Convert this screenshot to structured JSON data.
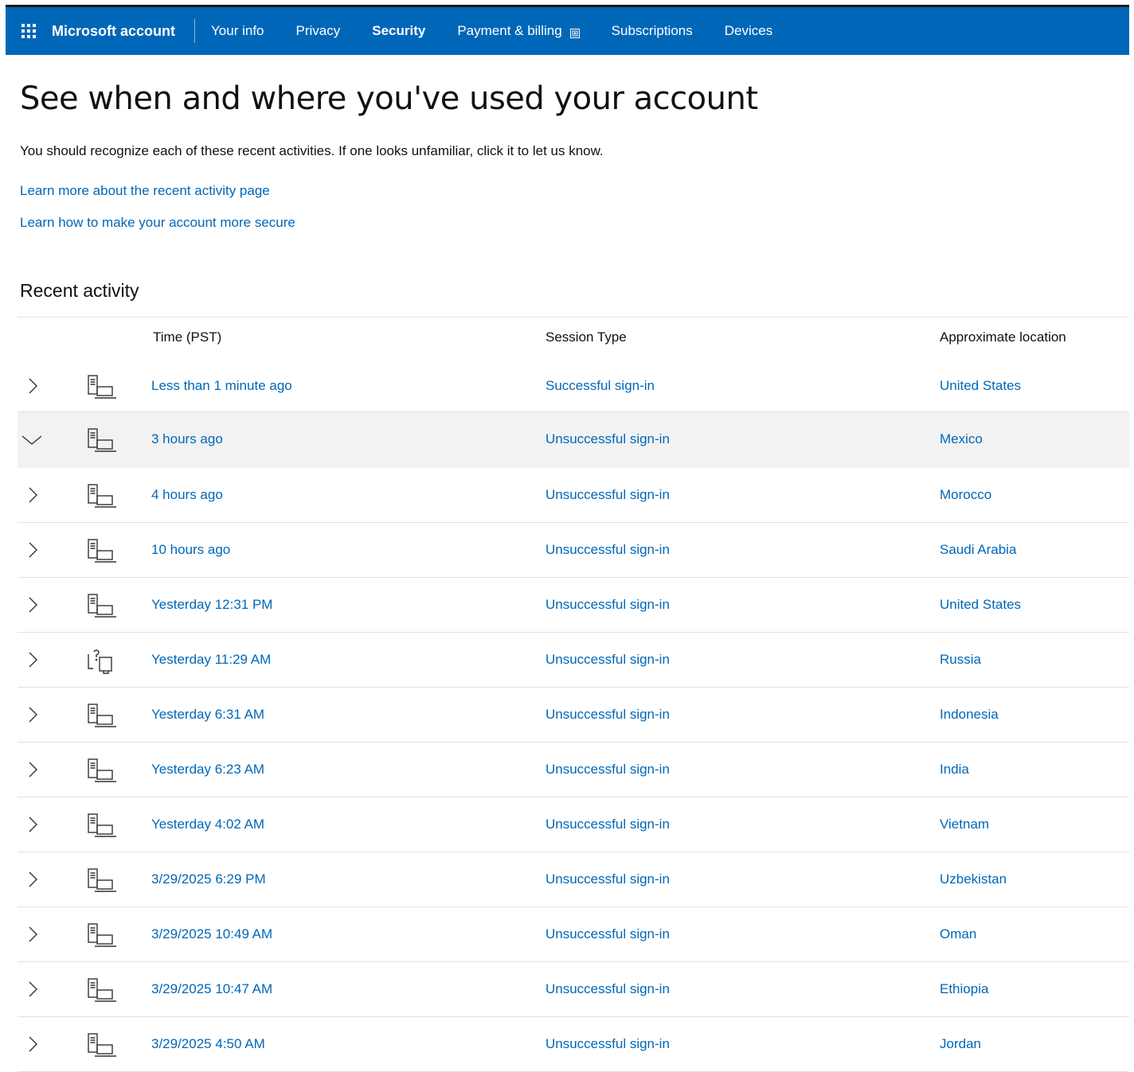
{
  "nav": {
    "brand": "Microsoft account",
    "links": [
      "Your info",
      "Privacy",
      "Security",
      "Payment & billing",
      "Subscriptions",
      "Devices"
    ],
    "active": "Security",
    "accent": "#0067b8"
  },
  "page": {
    "title": "See when and where you've used your account",
    "intro": "You should recognize each of these recent activities. If one looks unfamiliar, click it to let us know.",
    "learn_more": "Learn more about the recent activity page",
    "learn_secure": "Learn how to make your account more secure"
  },
  "activity": {
    "heading": "Recent activity",
    "columns": {
      "time": "Time (PST)",
      "session": "Session Type",
      "location": "Approximate location"
    },
    "rows": [
      {
        "time": "Less than 1 minute ago",
        "session": "Successful sign-in",
        "location": "United States",
        "device_icon": "computer-icon",
        "expanded": false
      },
      {
        "time": "3 hours ago",
        "session": "Unsuccessful sign-in",
        "location": "Mexico",
        "device_icon": "computer-icon",
        "expanded": true
      },
      {
        "time": "4 hours ago",
        "session": "Unsuccessful sign-in",
        "location": "Morocco",
        "device_icon": "computer-icon",
        "expanded": false
      },
      {
        "time": "10 hours ago",
        "session": "Unsuccessful sign-in",
        "location": "Saudi Arabia",
        "device_icon": "computer-icon",
        "expanded": false
      },
      {
        "time": "Yesterday 12:31 PM",
        "session": "Unsuccessful sign-in",
        "location": "United States",
        "device_icon": "computer-icon",
        "expanded": false
      },
      {
        "time": "Yesterday 11:29 AM",
        "session": "Unsuccessful sign-in",
        "location": "Russia",
        "device_icon": "unknown-device-icon",
        "expanded": false
      },
      {
        "time": "Yesterday 6:31 AM",
        "session": "Unsuccessful sign-in",
        "location": "Indonesia",
        "device_icon": "computer-icon",
        "expanded": false
      },
      {
        "time": "Yesterday 6:23 AM",
        "session": "Unsuccessful sign-in",
        "location": "India",
        "device_icon": "computer-icon",
        "expanded": false
      },
      {
        "time": "Yesterday 4:02 AM",
        "session": "Unsuccessful sign-in",
        "location": "Vietnam",
        "device_icon": "computer-icon",
        "expanded": false
      },
      {
        "time": "3/29/2025 6:29 PM",
        "session": "Unsuccessful sign-in",
        "location": "Uzbekistan",
        "device_icon": "computer-icon",
        "expanded": false
      },
      {
        "time": "3/29/2025 10:49 AM",
        "session": "Unsuccessful sign-in",
        "location": "Oman",
        "device_icon": "computer-icon",
        "expanded": false
      },
      {
        "time": "3/29/2025 10:47 AM",
        "session": "Unsuccessful sign-in",
        "location": "Ethiopia",
        "device_icon": "computer-icon",
        "expanded": false
      },
      {
        "time": "3/29/2025 4:50 AM",
        "session": "Unsuccessful sign-in",
        "location": "Jordan",
        "device_icon": "computer-icon",
        "expanded": false
      }
    ]
  }
}
